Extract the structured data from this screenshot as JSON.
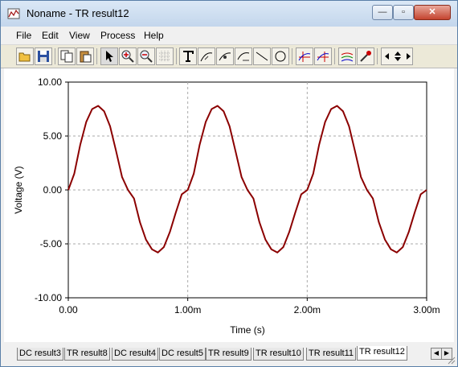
{
  "window": {
    "title": "Noname - TR result12"
  },
  "menu": [
    "File",
    "Edit",
    "View",
    "Process",
    "Help"
  ],
  "toolbar": {
    "icons": [
      "open-icon",
      "save-icon",
      "copy-icon",
      "paste-icon",
      "pointer-icon",
      "zoom-in-icon",
      "zoom-out-icon",
      "grid-icon",
      "text-icon",
      "label-curve-icon",
      "label-point-icon",
      "label-area-icon",
      "line-icon",
      "circle-icon",
      "cursor-a-icon",
      "cursor-b-icon",
      "curves-icon",
      "eyedropper-icon",
      "scroll-arrows-icon"
    ]
  },
  "tabs": [
    "DC result3",
    "TR result8",
    "DC result4",
    "DC result5",
    "TR result9",
    "TR result10",
    "TR result11",
    "TR result12"
  ],
  "active_tab": "TR result12",
  "chart_data": {
    "type": "line",
    "xlabel": "Time (s)",
    "ylabel": "Voltage (V)",
    "xlim": [
      0,
      0.003
    ],
    "ylim": [
      -10,
      10
    ],
    "x_ticks": [
      "0.00",
      "1.00m",
      "2.00m",
      "3.00m"
    ],
    "y_ticks": [
      "10.00",
      "5.00",
      "0.00",
      "-5.00",
      "-10.00"
    ],
    "grid": true,
    "line_color": "#8b0000",
    "series": [
      {
        "x": [
          0.0,
          5e-05,
          0.0001,
          0.00015,
          0.0002,
          0.00025,
          0.0003,
          0.00035,
          0.0004,
          0.00045,
          0.0005,
          0.00055,
          0.0006,
          0.00065,
          0.0007,
          0.00075,
          0.0008,
          0.00085,
          0.0009,
          0.00095,
          0.001,
          0.00105,
          0.0011,
          0.00115,
          0.0012,
          0.00125,
          0.0013,
          0.00135,
          0.0014,
          0.00145,
          0.0015,
          0.00155,
          0.0016,
          0.00165,
          0.0017,
          0.00175,
          0.0018,
          0.00185,
          0.0019,
          0.00195,
          0.002,
          0.00205,
          0.0021,
          0.00215,
          0.0022,
          0.00225,
          0.0023,
          0.00235,
          0.0024,
          0.00245,
          0.0025,
          0.00255,
          0.0026,
          0.00265,
          0.0027,
          0.00275,
          0.0028,
          0.00285,
          0.0029,
          0.00295,
          0.003
        ],
        "y": [
          0.0,
          1.5,
          4.2,
          6.3,
          7.5,
          7.8,
          7.3,
          5.9,
          3.6,
          1.2,
          0.0,
          -0.8,
          -3.0,
          -4.6,
          -5.5,
          -5.8,
          -5.3,
          -3.9,
          -2.1,
          -0.4,
          0.0,
          1.5,
          4.2,
          6.3,
          7.5,
          7.8,
          7.3,
          5.9,
          3.6,
          1.2,
          0.0,
          -0.8,
          -3.0,
          -4.6,
          -5.5,
          -5.8,
          -5.3,
          -3.9,
          -2.1,
          -0.4,
          0.0,
          1.5,
          4.2,
          6.3,
          7.5,
          7.8,
          7.3,
          5.9,
          3.6,
          1.2,
          0.0,
          -0.8,
          -3.0,
          -4.6,
          -5.5,
          -5.8,
          -5.3,
          -3.9,
          -2.1,
          -0.4,
          0.0
        ]
      }
    ]
  }
}
